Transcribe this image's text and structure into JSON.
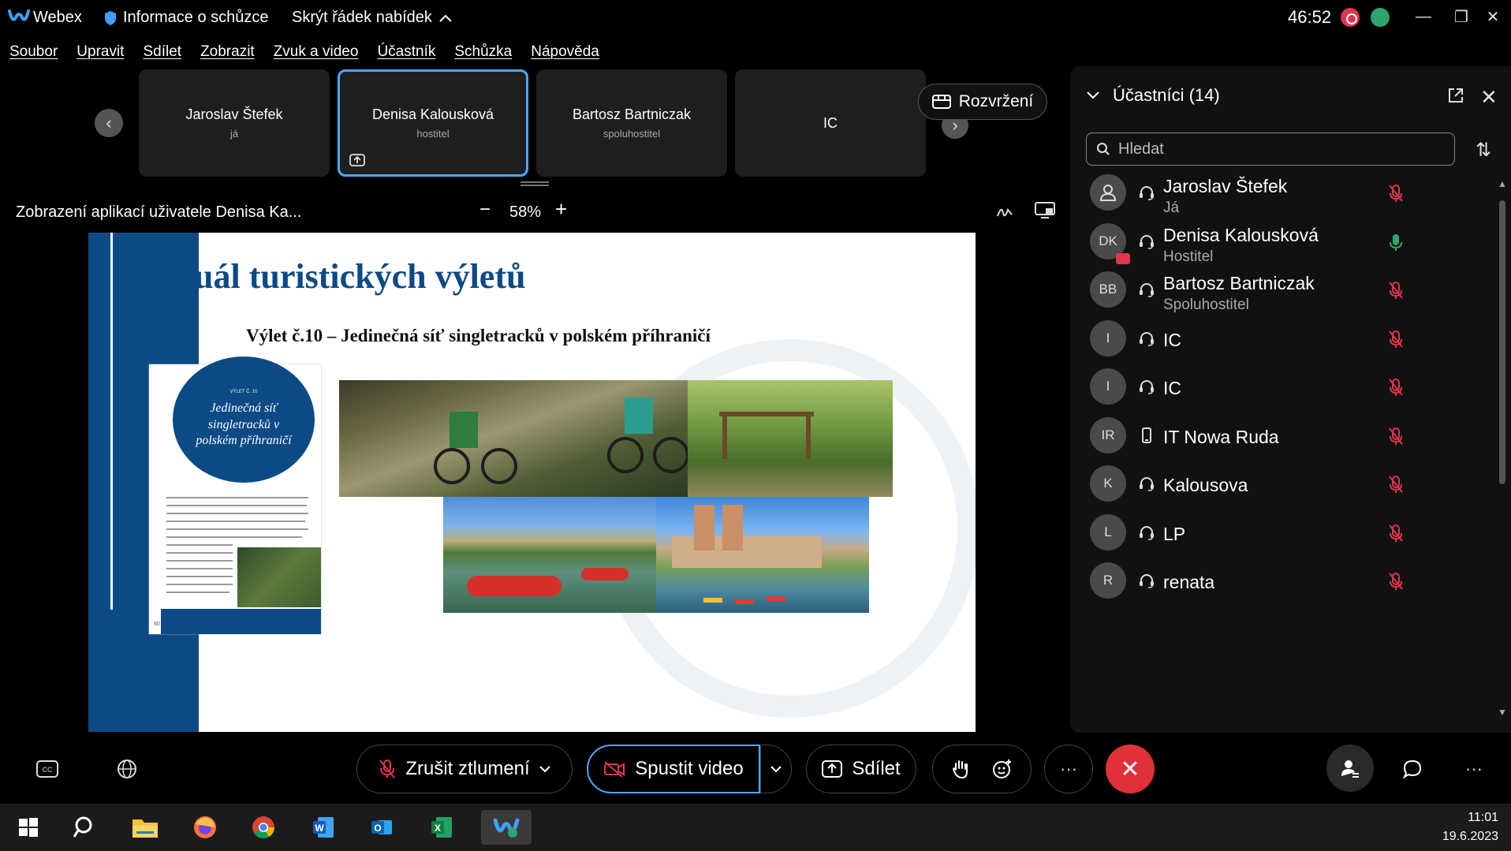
{
  "titlebar": {
    "app_name": "Webex",
    "meeting_info": "Informace o schůzce",
    "hide_menu": "Skrýt řádek nabídek",
    "timer": "46:52",
    "minimize": "—",
    "restore": "❐",
    "close": "✕"
  },
  "menu": [
    "Soubor",
    "Upravit",
    "Sdílet",
    "Zobrazit",
    "Zvuk a video",
    "Účastník",
    "Schůzka",
    "Nápověda"
  ],
  "thumbnails": [
    {
      "name": "Jaroslav Štefek",
      "role": "já"
    },
    {
      "name": "Denisa Kalousková",
      "role": "hostitel"
    },
    {
      "name": "Bartosz Bartniczak",
      "role": "spoluhostitel"
    },
    {
      "name": "IC",
      "role": ""
    }
  ],
  "layout_button": "Rozvržení",
  "share_toolbar": {
    "title": "Zobrazení aplikací uživatele Denisa Ka...",
    "zoom": "58%",
    "zoom_out": "−",
    "zoom_in": "+"
  },
  "slide": {
    "title": "Manuál turistických výletů",
    "subtitle": "Výlet č.10 – Jedinečná síť singletracků v polském příhraničí",
    "brochure_label": "VÝLET Č. 10",
    "brochure_heading": "Jedinečná síť singletracků v polském příhraničí",
    "brochure_page": "60"
  },
  "participants_panel": {
    "title": "Účastníci (14)",
    "search_placeholder": "Hledat",
    "participants": [
      {
        "initials": "",
        "name": "Jaroslav Štefek",
        "role": "Já",
        "mic": "muted",
        "audio": "headset"
      },
      {
        "initials": "DK",
        "name": "Denisa Kalousková",
        "role": "Hostitel",
        "mic": "active",
        "audio": "headset"
      },
      {
        "initials": "BB",
        "name": "Bartosz Bartniczak",
        "role": "Spoluhostitel",
        "mic": "muted",
        "audio": "headset"
      },
      {
        "initials": "I",
        "name": "IC",
        "role": "",
        "mic": "muted",
        "audio": "headset"
      },
      {
        "initials": "I",
        "name": "IC",
        "role": "",
        "mic": "muted",
        "audio": "headset"
      },
      {
        "initials": "IR",
        "name": "IT Nowa Ruda",
        "role": "",
        "mic": "muted",
        "audio": "phone"
      },
      {
        "initials": "K",
        "name": "Kalousova",
        "role": "",
        "mic": "muted",
        "audio": "headset"
      },
      {
        "initials": "L",
        "name": "LP",
        "role": "",
        "mic": "muted",
        "audio": "headset"
      },
      {
        "initials": "R",
        "name": "renata",
        "role": "",
        "mic": "muted",
        "audio": "headset"
      }
    ]
  },
  "controls": {
    "unmute": "Zrušit ztlumení",
    "start_video": "Spustit video",
    "share": "Sdílet",
    "more": "···"
  },
  "taskbar": {
    "time": "11:01",
    "date": "19.6.2023"
  },
  "colors": {
    "accent_blue": "#4aa8ff",
    "leave_red": "#e0303a",
    "mic_muted": "#e0344f",
    "mic_active": "#2fa56b",
    "slide_blue": "#0c4a86"
  }
}
